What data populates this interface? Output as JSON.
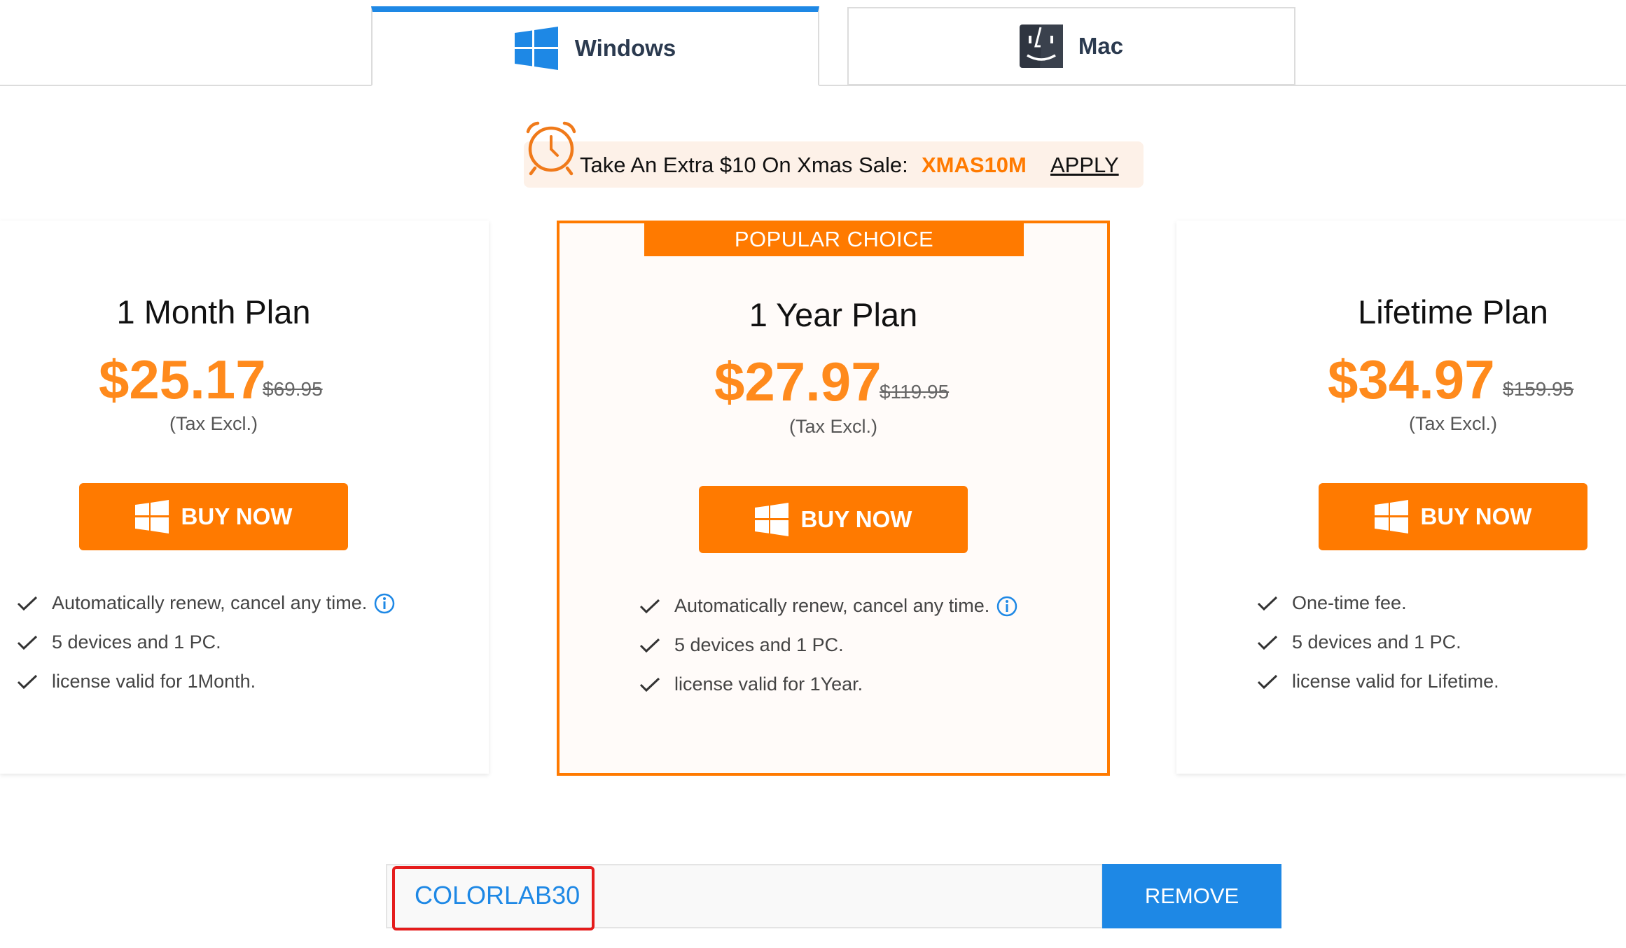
{
  "tabs": {
    "windows": {
      "label": "Windows",
      "active": true,
      "icon": "windows-icon"
    },
    "mac": {
      "label": "Mac",
      "active": false,
      "icon": "mac-finder-icon"
    }
  },
  "promo": {
    "text": "Take An Extra $10 On Xmas Sale:",
    "code": "XMAS10M",
    "apply_label": "APPLY",
    "icon": "alarm-clock-icon"
  },
  "plans": [
    {
      "title": "1 Month Plan",
      "price": "$25.17",
      "original_price": "$69.95",
      "tax_note": "(Tax Excl.)",
      "buy_label": "BUY NOW",
      "features": [
        "Automatically renew, cancel any time.",
        "5 devices and 1 PC.",
        "license valid for 1Month."
      ]
    },
    {
      "ribbon": "POPULAR CHOICE",
      "title": "1 Year Plan",
      "price": "$27.97",
      "original_price": "$119.95",
      "tax_note": "(Tax Excl.)",
      "buy_label": "BUY NOW",
      "features": [
        "Automatically renew, cancel any time.",
        "5 devices and 1 PC.",
        "license valid for 1Year."
      ]
    },
    {
      "title": "Lifetime Plan",
      "price": "$34.97",
      "original_price": "$159.95",
      "tax_note": "(Tax Excl.)",
      "buy_label": "BUY NOW",
      "features": [
        "One-time fee.",
        "5 devices and 1 PC.",
        "license valid for Lifetime."
      ]
    }
  ],
  "coupon": {
    "applied_code": "COLORLAB30",
    "remove_label": "REMOVE"
  },
  "colors": {
    "accent_orange": "#ff7a00",
    "accent_blue": "#1e88e5",
    "highlight_red": "#e51c1c"
  }
}
